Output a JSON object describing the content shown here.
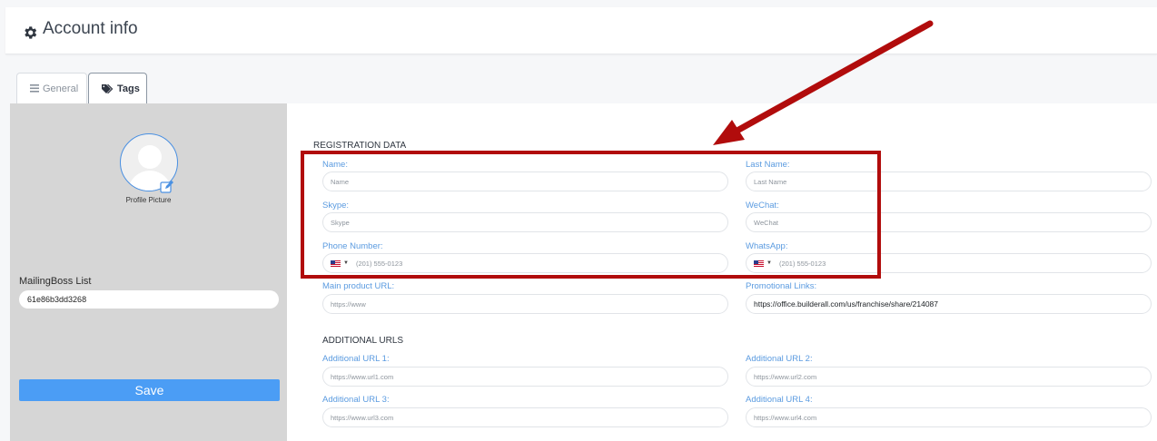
{
  "header": {
    "title": "Account info",
    "icon": "gear-icon"
  },
  "tabs": [
    {
      "label": "General",
      "icon": "list-icon",
      "active": false
    },
    {
      "label": "Tags",
      "icon": "tags-icon",
      "active": true
    }
  ],
  "sidebar": {
    "profile_label": "Profile Picture",
    "mailingboss_label": "MailingBoss List",
    "mailingboss_value": "61e86b3dd3268",
    "save_label": "Save"
  },
  "registration": {
    "title": "REGISTRATION DATA",
    "name": {
      "label": "Name:",
      "placeholder": "Name"
    },
    "last_name": {
      "label": "Last Name:",
      "placeholder": "Last Name"
    },
    "skype": {
      "label": "Skype:",
      "placeholder": "Skype"
    },
    "wechat": {
      "label": "WeChat:",
      "placeholder": "WeChat"
    },
    "phone": {
      "label": "Phone Number:",
      "placeholder": "(201) 555-0123"
    },
    "whatsapp": {
      "label": "WhatsApp:",
      "placeholder": "(201) 555-0123"
    },
    "main_url": {
      "label": "Main product URL:",
      "placeholder": "https://www"
    },
    "promo": {
      "label": "Promotional Links:",
      "value": "https://office.builderall.com/us/franchise/share/214087"
    }
  },
  "additional": {
    "title": "ADDITIONAL URLS",
    "url1": {
      "label": "Additional URL 1:",
      "placeholder": "https://www.url1.com"
    },
    "url2": {
      "label": "Additional URL 2:",
      "placeholder": "https://www.url2.com"
    },
    "url3": {
      "label": "Additional URL 3:",
      "placeholder": "https://www.url3.com"
    },
    "url4": {
      "label": "Additional URL 4:",
      "placeholder": "https://www.url4.com"
    }
  },
  "colors": {
    "accent": "#5b9be0",
    "save": "#4b9df5",
    "annotation": "#b10c0c"
  }
}
